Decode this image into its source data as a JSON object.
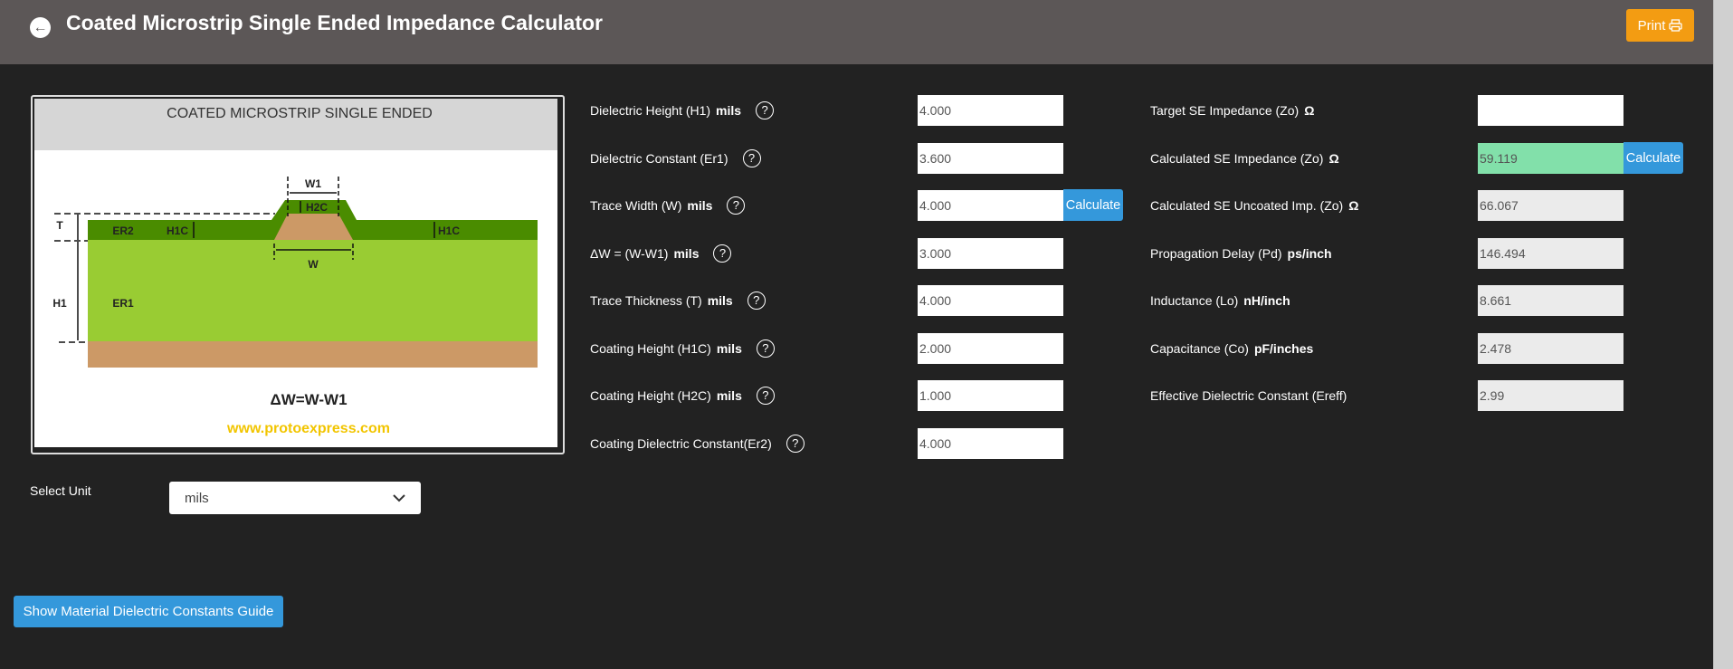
{
  "header": {
    "title": "Coated Microstrip Single Ended Impedance Calculator",
    "back_icon": "arrow-left-circle-icon",
    "print_label": "Print",
    "print_icon": "printer-icon"
  },
  "figure": {
    "title": "COATED MICROSTRIP SINGLE ENDED",
    "labels": {
      "w1": "W1",
      "h2c": "H2C",
      "t": "T",
      "er2": "ER2",
      "h1c_left": "H1C",
      "h1c_right": "H1C",
      "w": "W",
      "h1": "H1",
      "er1": "ER1"
    },
    "formula": "ΔW=W-W1",
    "website": "www.protoexpress.com"
  },
  "inputs": [
    {
      "label": "Dielectric Height (H1)",
      "unit": "mils",
      "value": "4.000"
    },
    {
      "label": "Dielectric Constant (Er1)",
      "unit": "",
      "value": "3.600"
    },
    {
      "label": "Trace Width (W)",
      "unit": "mils",
      "value": "4.000"
    },
    {
      "label": "ΔW = (W-W1)",
      "unit": "mils",
      "value": "3.000"
    },
    {
      "label": "Trace Thickness (T)",
      "unit": "mils",
      "value": "4.000"
    },
    {
      "label": "Coating Height (H1C)",
      "unit": "mils",
      "value": "2.000"
    },
    {
      "label": "Coating Height (H2C)",
      "unit": "mils",
      "value": "1.000"
    },
    {
      "label": "Coating Dielectric Constant(Er2)",
      "unit": "",
      "value": "4.000"
    }
  ],
  "help_glyph": "?",
  "calculate_label": "Calculate",
  "outputs": [
    {
      "label": "Target SE Impedance (Zo)",
      "unit": "Ω",
      "value": ""
    },
    {
      "label": "Calculated SE Impedance (Zo)",
      "unit": "Ω",
      "value": "59.119"
    },
    {
      "label": "Calculated SE Uncoated Imp. (Zo)",
      "unit": "Ω",
      "value": "66.067"
    },
    {
      "label": "Propagation Delay (Pd)",
      "unit": "ps/inch",
      "value": "146.494"
    },
    {
      "label": "Inductance (Lo)",
      "unit": "nH/inch",
      "value": "8.661"
    },
    {
      "label": "Capacitance (Co)",
      "unit": "pF/inches",
      "value": "2.478"
    },
    {
      "label": "Effective Dielectric Constant (Ereff)",
      "unit": "",
      "value": "2.99"
    }
  ],
  "unit_select": {
    "label": "Select Unit",
    "value": "mils"
  },
  "guide_button": "Show Material Dielectric Constants Guide",
  "colors": {
    "header": "#5c5757",
    "accent_blue": "#3498db",
    "print_orange": "#f39c12",
    "result_green": "#82e0aa",
    "background": "#222222"
  }
}
